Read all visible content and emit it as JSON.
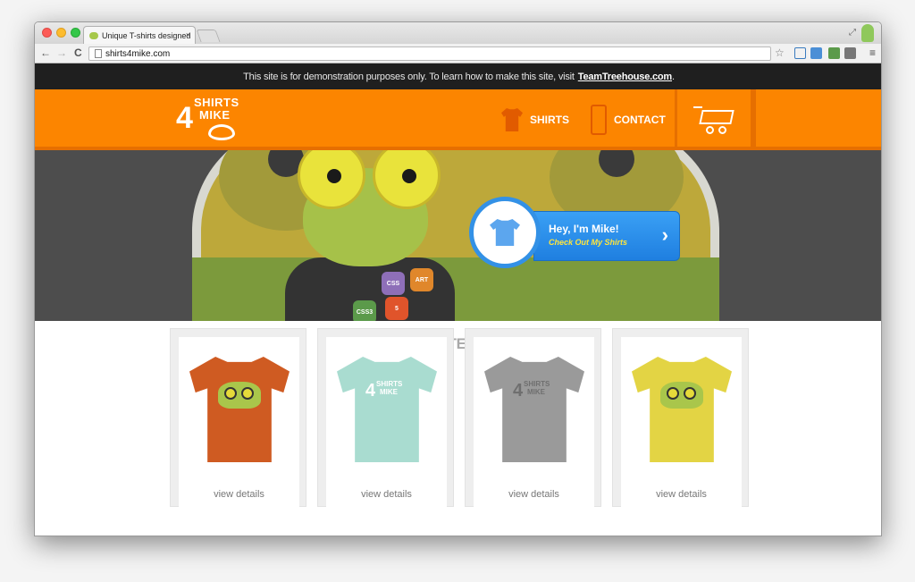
{
  "browser": {
    "tab_title": "Unique T-shirts designed",
    "tab_close": "×",
    "url": "shirts4mike.com",
    "back": "←",
    "forward": "→",
    "reload": "C",
    "star": "☆",
    "menu": "≡",
    "resize": "⤢"
  },
  "demo_bar": {
    "text": "This site is for demonstration purposes only. To learn how to make this site, visit",
    "link": "TeamTreehouse.com",
    "suffix": "."
  },
  "header": {
    "logo_line1": "SHIRTS",
    "logo_line2": "MIKE",
    "logo_four": "4",
    "nav": {
      "shirts": "SHIRTS",
      "contact": "CONTACT"
    }
  },
  "hero": {
    "cta_title": "Hey, I'm Mike!",
    "cta_sub": "Check Out My Shirts",
    "cta_arrow": "›",
    "badges": [
      "CSS",
      "ART",
      "CSS3",
      "5"
    ]
  },
  "latest": {
    "title": "MIKE'S LATEST SHIRTS",
    "products": [
      {
        "color": "#cf5b22",
        "design": "frog",
        "link": "view details"
      },
      {
        "color": "#a9dcd0",
        "design": "logo",
        "link": "view details"
      },
      {
        "color": "#9a9a9a",
        "design": "logo",
        "link": "view details"
      },
      {
        "color": "#e3d444",
        "design": "frog",
        "link": "view details"
      }
    ]
  },
  "colors": {
    "brand_orange": "#fc8500",
    "demo_bar": "#1f1f1f",
    "cta_blue": "#2589e8"
  }
}
